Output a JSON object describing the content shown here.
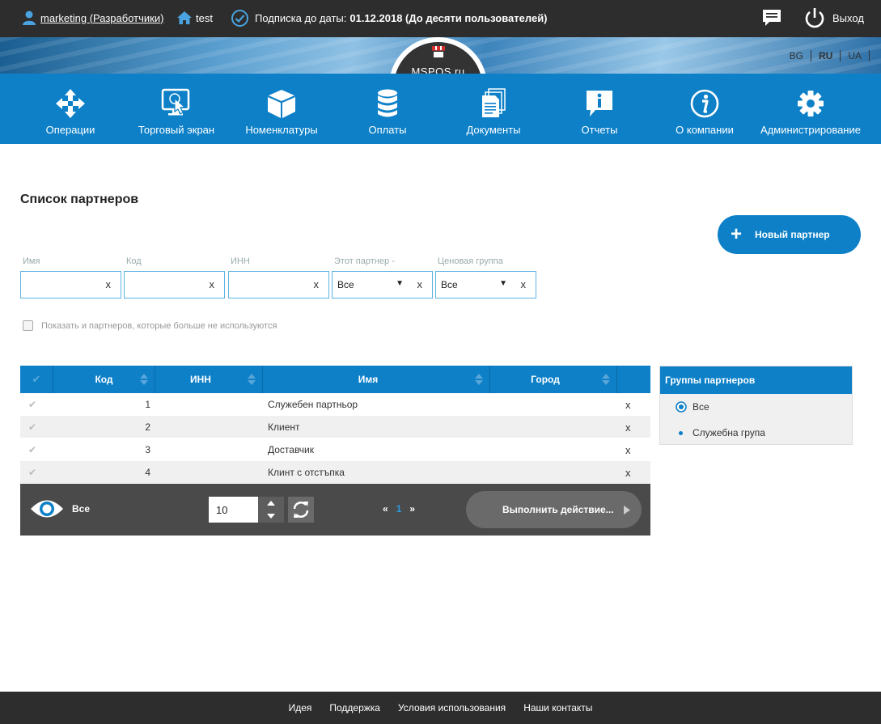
{
  "topbar": {
    "user": "marketing (Разработчики)",
    "store": "test",
    "subscription_prefix": "Подписка до даты:",
    "subscription_value": "01.12.2018 (До десяти пользователей)",
    "logout": "Выход"
  },
  "banner": {
    "logo_text": "MSPOS.ru",
    "languages": [
      "BG",
      "RU",
      "UA"
    ],
    "active_language": "RU"
  },
  "nav": [
    {
      "label": "Операции",
      "icon": "arrows-move-icon"
    },
    {
      "label": "Торговый экран",
      "icon": "touch-screen-icon"
    },
    {
      "label": "Номенклатуры",
      "icon": "box-icon"
    },
    {
      "label": "Оплаты",
      "icon": "coins-stack-icon"
    },
    {
      "label": "Документы",
      "icon": "documents-icon"
    },
    {
      "label": "Отчеты",
      "icon": "info-bubble-icon"
    },
    {
      "label": "О компании",
      "icon": "info-circle-icon"
    },
    {
      "label": "Администрирование",
      "icon": "gear-icon"
    }
  ],
  "page": {
    "title": "Список партнеров",
    "new_partner": "Новый партнер"
  },
  "filters": {
    "name_label": "Имя",
    "code_label": "Код",
    "inn_label": "ИНН",
    "this_partner_label": "Этот партнер -",
    "this_partner_value": "Все",
    "price_group_label": "Ценовая группа",
    "price_group_value": "Все",
    "clear": "x",
    "show_unused": "Показать и партнеров, которые больше не используются"
  },
  "grid": {
    "columns": [
      "Код",
      "ИНН",
      "Имя",
      "Город"
    ],
    "rows": [
      {
        "code": "1",
        "inn": "",
        "name": "Служебен партньор",
        "city": "",
        "del": "x"
      },
      {
        "code": "2",
        "inn": "",
        "name": "Клиент",
        "city": "",
        "del": "x"
      },
      {
        "code": "3",
        "inn": "",
        "name": "Доставчик",
        "city": "",
        "del": "x"
      },
      {
        "code": "4",
        "inn": "",
        "name": "Клинт с отстъпка",
        "city": "",
        "del": "x"
      }
    ],
    "view_label": "Все",
    "page_size": "10",
    "pager_prev": "«",
    "pager_page": "1",
    "pager_next": "»",
    "action_label": "Выполнить действие..."
  },
  "groups": {
    "title": "Группы партнеров",
    "items": [
      "Все",
      "Служебна група"
    ]
  },
  "footer": [
    "Идея",
    "Поддержка",
    "Условия использования",
    "Наши контакты"
  ],
  "colors": {
    "accent": "#0d80c8",
    "dark": "#2d2d2d"
  }
}
